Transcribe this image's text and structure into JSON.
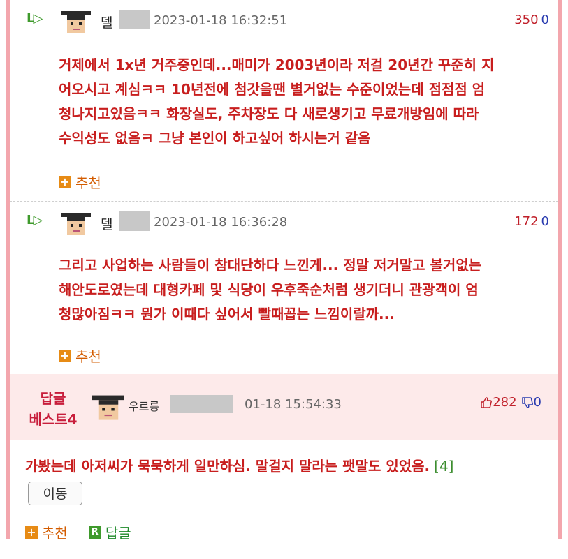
{
  "comments": [
    {
      "nick": "델",
      "date": "2023-01-18 16:32:51",
      "score": "350",
      "dislike": "0",
      "lines": [
        "거제에서 1x년 거주중인데...매미가 2003년이라 저걸 20년간 꾸준히 지",
        "어오시고 계심ㅋㅋ 10년전에 첨갓을땐 별거없는 수준이었는데 점점점 엄",
        "청나지고있음ㅋㅋ 화장실도, 주차장도 다 새로생기고 무료개방임에 따라",
        "수익성도 없음ㅋ 그냥 본인이 하고싶어 하시는거 같음"
      ],
      "recommend": "추천"
    },
    {
      "nick": "델",
      "date": "2023-01-18 16:36:28",
      "score": "172",
      "dislike": "0",
      "lines": [
        "그리고 사업하는 사람들이 참대단하다 느낀게... 정말 저거말고 볼거없는",
        "해안도로였는데 대형카페 및 식당이 우후죽순처럼 생기더니 관광객이 엄",
        "청많아짐ㅋㅋ 뭔가 이때다 싶어서 빨때꼽는 느낌이랄까..."
      ],
      "recommend": "추천"
    }
  ],
  "best": {
    "label_line1": "답글",
    "label_line2": "베스트4",
    "nick": "우르릉",
    "date": "01-18 15:54:33",
    "up": "282",
    "down": "0",
    "text": "가봤는데 아저씨가 묵묵하게 일만하심. 말걸지 말라는 팻말도 있었음.",
    "reply_count": "[4]",
    "move_button": "이동",
    "recommend": "추천",
    "reply": "답글"
  },
  "icons": {
    "reply_arrow": "reply-arrow-icon",
    "plus": "plus-icon",
    "thumb_up": "thumbs-up-icon",
    "thumb_down": "thumbs-down-icon"
  },
  "colors": {
    "frame": "#f3a6ad",
    "comment_text": "#c81e1e",
    "best_bg": "#fdeaea"
  }
}
